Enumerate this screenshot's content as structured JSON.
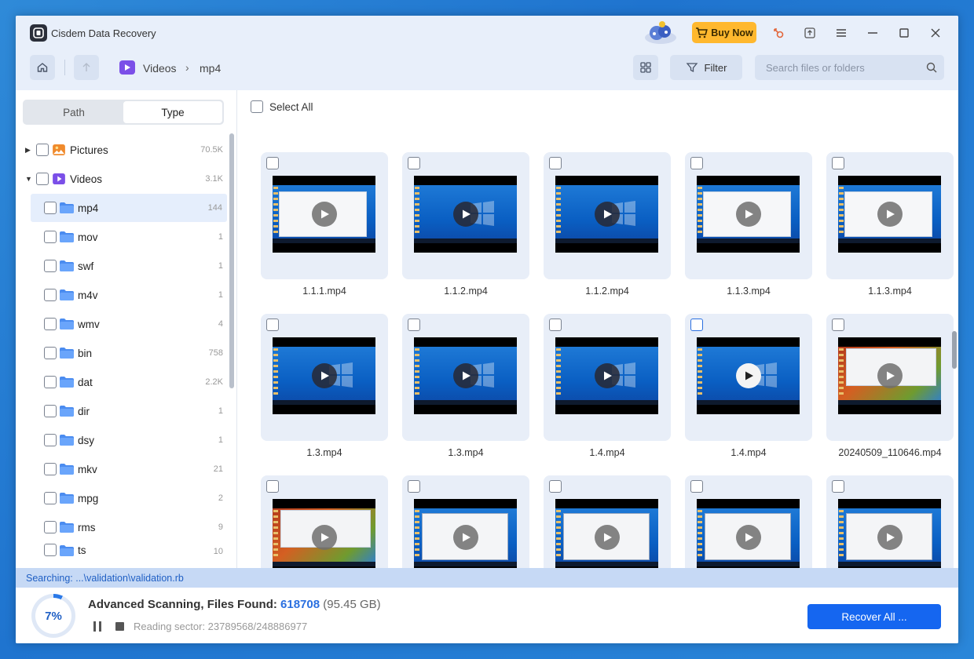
{
  "app": {
    "title": "Cisdem Data Recovery",
    "buy_now": "Buy Now"
  },
  "nav": {
    "crumbs": [
      "Videos",
      "mp4"
    ],
    "filter_label": "Filter",
    "search_placeholder": "Search files or folders"
  },
  "sidebar": {
    "tabs": [
      "Path",
      "Type"
    ],
    "active_tab": "Type",
    "tree": [
      {
        "label": "Pictures",
        "count": "70.5K"
      },
      {
        "label": "Videos",
        "count": "3.1K"
      },
      {
        "label": "mp4",
        "count": "144"
      },
      {
        "label": "mov",
        "count": "1"
      },
      {
        "label": "swf",
        "count": "1"
      },
      {
        "label": "m4v",
        "count": "1"
      },
      {
        "label": "wmv",
        "count": "4"
      },
      {
        "label": "bin",
        "count": "758"
      },
      {
        "label": "dat",
        "count": "2.2K"
      },
      {
        "label": "dir",
        "count": "1"
      },
      {
        "label": "dsy",
        "count": "1"
      },
      {
        "label": "mkv",
        "count": "21"
      },
      {
        "label": "mpg",
        "count": "2"
      },
      {
        "label": "rms",
        "count": "9"
      },
      {
        "label": "ts",
        "count": "10"
      }
    ]
  },
  "main": {
    "select_all": "Select All",
    "files": [
      {
        "name": "1.1.1.mp4"
      },
      {
        "name": "1.1.2.mp4"
      },
      {
        "name": "1.1.2.mp4"
      },
      {
        "name": "1.1.3.mp4"
      },
      {
        "name": "1.1.3.mp4"
      },
      {
        "name": "1.3.mp4"
      },
      {
        "name": "1.3.mp4"
      },
      {
        "name": "1.4.mp4"
      },
      {
        "name": "1.4.mp4"
      },
      {
        "name": "20240509_110646.mp4"
      },
      {
        "name": ""
      },
      {
        "name": ""
      },
      {
        "name": ""
      },
      {
        "name": ""
      },
      {
        "name": ""
      }
    ]
  },
  "status": {
    "searching": "Searching: ...\\validation\\validation.rb",
    "progress_text": "7%",
    "progress_fraction": 0.07,
    "scan_label": "Advanced Scanning, Files Found:",
    "files_found": "618708",
    "size": "(95.45 GB)",
    "reading": "Reading sector: 23789568/248886977",
    "recover_label": "Recover All ..."
  },
  "colors": {
    "accent": "#1566f0",
    "buy_now": "#ffb82e",
    "videos_icon": "#7b4fe8"
  }
}
